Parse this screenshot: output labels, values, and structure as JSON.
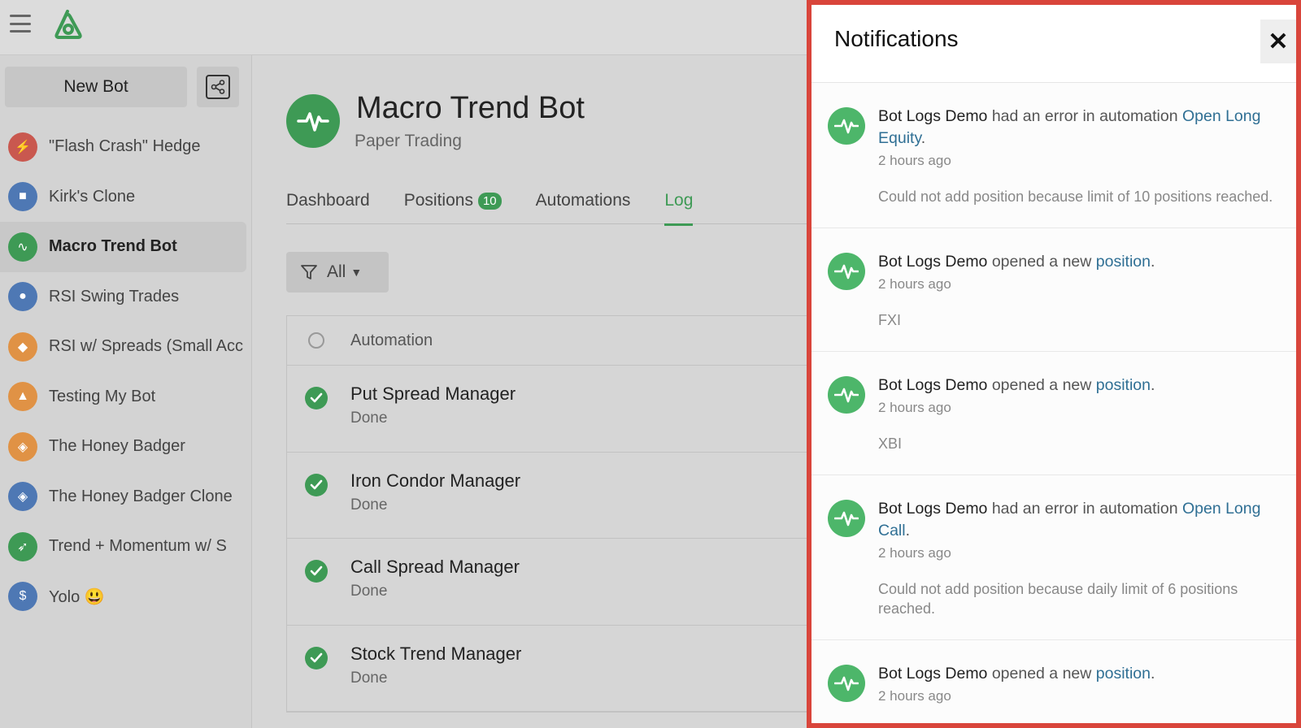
{
  "sidebar": {
    "new_bot_label": "New Bot",
    "bots": [
      {
        "label": "\"Flash Crash\" Hedge",
        "color": "#c9584f",
        "icon": "lightning-icon",
        "glyph": "⚡"
      },
      {
        "label": "Kirk's Clone",
        "color": "#4e78b4",
        "icon": "robot-icon",
        "glyph": "■"
      },
      {
        "label": "Macro Trend Bot",
        "color": "#3e9a55",
        "icon": "pulse-icon",
        "glyph": "∿"
      },
      {
        "label": "RSI Swing Trades",
        "color": "#4e78b4",
        "icon": "globe-icon",
        "glyph": "●"
      },
      {
        "label": "RSI w/ Spreads (Small Acc",
        "color": "#e09245",
        "icon": "piggy-bank-icon",
        "glyph": "◆"
      },
      {
        "label": "Testing My Bot",
        "color": "#e09245",
        "icon": "hard-hat-icon",
        "glyph": "▲"
      },
      {
        "label": "The Honey Badger",
        "color": "#e09245",
        "icon": "badger-icon",
        "glyph": "◈"
      },
      {
        "label": "The Honey Badger Clone",
        "color": "#4e78b4",
        "icon": "badger-icon",
        "glyph": "◈"
      },
      {
        "label": "Trend + Momentum w/ S",
        "color": "#3e9a55",
        "icon": "rocket-icon",
        "glyph": "➶"
      },
      {
        "label": "Yolo 😃",
        "color": "#4e78b4",
        "icon": "money-bag-icon",
        "glyph": "$"
      }
    ],
    "active_index": 2
  },
  "main": {
    "title": "Macro Trend Bot",
    "subtitle": "Paper Trading",
    "tabs": [
      {
        "label": "Dashboard"
      },
      {
        "label": "Positions",
        "badge": "10"
      },
      {
        "label": "Automations"
      },
      {
        "label": "Log"
      }
    ],
    "active_tab": 3,
    "filter_label": "All",
    "table_header": "Automation",
    "rows": [
      {
        "title": "Put Spread Manager",
        "status": "Done"
      },
      {
        "title": "Iron Condor Manager",
        "status": "Done"
      },
      {
        "title": "Call Spread Manager",
        "status": "Done"
      },
      {
        "title": "Stock Trend Manager",
        "status": "Done"
      }
    ]
  },
  "notifications": {
    "title": "Notifications",
    "close_glyph": "✕",
    "items": [
      {
        "actor": "Bot Logs Demo",
        "action": " had an error in automation ",
        "link": "Open Long Equity",
        "tail": ".",
        "time": "2 hours ago",
        "detail": "Could not add position because limit of 10 positions reached."
      },
      {
        "actor": "Bot Logs Demo",
        "action": " opened a new ",
        "link": "position",
        "tail": ".",
        "time": "2 hours ago",
        "detail": "FXI"
      },
      {
        "actor": "Bot Logs Demo",
        "action": " opened a new ",
        "link": "position",
        "tail": ".",
        "time": "2 hours ago",
        "detail": "XBI"
      },
      {
        "actor": "Bot Logs Demo",
        "action": " had an error in automation ",
        "link": "Open Long Call",
        "tail": ".",
        "time": "2 hours ago",
        "detail": "Could not add position because daily limit of 6 positions reached."
      },
      {
        "actor": "Bot Logs Demo",
        "action": " opened a new ",
        "link": "position",
        "tail": ".",
        "time": "2 hours ago",
        "detail": ""
      }
    ]
  },
  "colors": {
    "accent": "#3e9a55",
    "highlight_border": "#d9453b",
    "link": "#2f6f94"
  }
}
